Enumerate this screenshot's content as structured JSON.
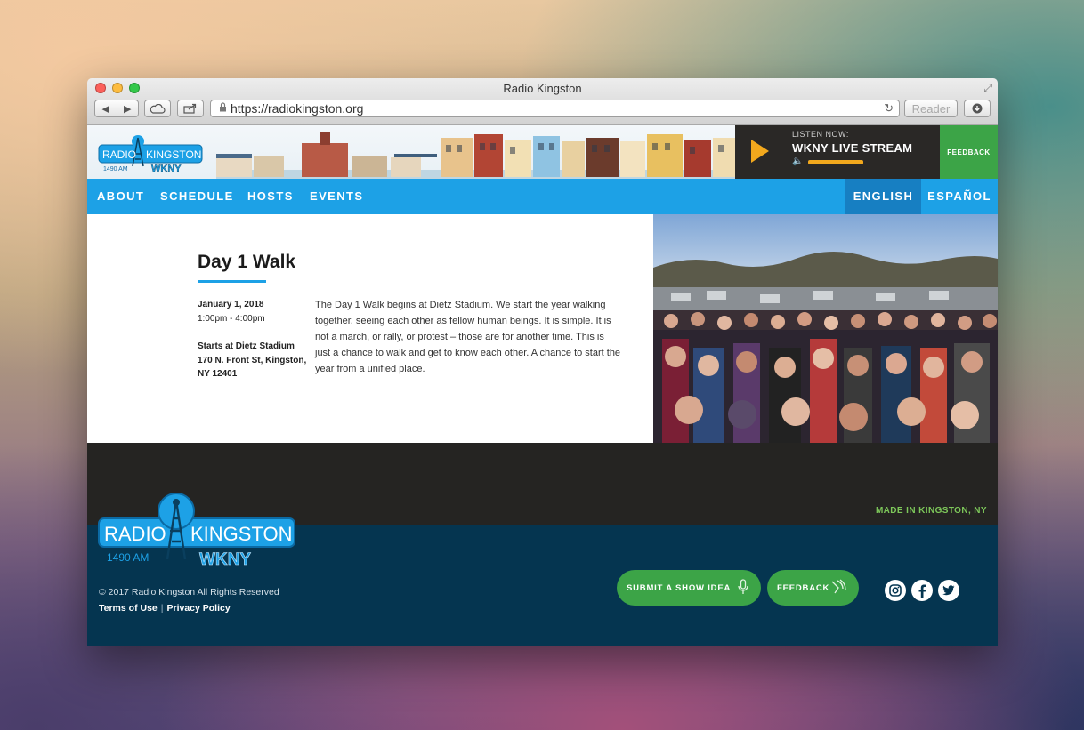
{
  "window": {
    "title": "Radio Kingston"
  },
  "toolbar": {
    "back_glyph": "◀",
    "forward_glyph": "▶",
    "url": "https://radiokingston.org",
    "reader_label": "Reader",
    "icons": [
      "back-icon",
      "forward-icon",
      "cloud-icon",
      "share-icon",
      "lock-icon",
      "reload-icon",
      "download-icon"
    ]
  },
  "header": {
    "logo": {
      "name": "RADIO KINGSTON",
      "freq": "1490 AM",
      "call": "WKNY"
    },
    "player": {
      "eyebrow": "LISTEN NOW:",
      "stream": "WKNY LIVE STREAM",
      "volume": 0.85
    },
    "feedback_label": "FEEDBACK"
  },
  "nav": {
    "items": [
      "ABOUT",
      "SCHEDULE",
      "HOSTS",
      "EVENTS"
    ],
    "lang_en": "ENGLISH",
    "lang_es": "ESPAÑOL"
  },
  "event": {
    "title": "Day 1 Walk",
    "date": "January 1, 2018",
    "time": "1:00pm - 4:00pm",
    "location_title": "Starts at Dietz Stadium",
    "address_line1": "170 N. Front St, Kingston,",
    "address_line2": "NY 12401",
    "description": "The Day 1 Walk begins at Dietz Stadium. We start the year walking together, seeing each other as fellow human beings. It is simple. It is not a march, or rally, or protest – those are for another time. This is just a chance to walk and get to know each other. A chance to start the year from a unified place."
  },
  "footer": {
    "made_in": "MADE IN KINGSTON, NY",
    "copyright": "© 2017 Radio Kingston All Rights Reserved",
    "terms": "Terms of Use",
    "separator": "|",
    "privacy": "Privacy Policy",
    "submit_label": "SUBMIT A SHOW IDEA",
    "feedback_label": "FEEDBACK",
    "social": [
      "instagram-icon",
      "facebook-icon",
      "twitter-icon"
    ]
  },
  "colors": {
    "brand_blue": "#1da1e6",
    "nav_active": "#177fc2",
    "green": "#3ca447",
    "play_orange": "#f2a81d",
    "footer_navy": "#053550",
    "dark_band": "#252422"
  }
}
